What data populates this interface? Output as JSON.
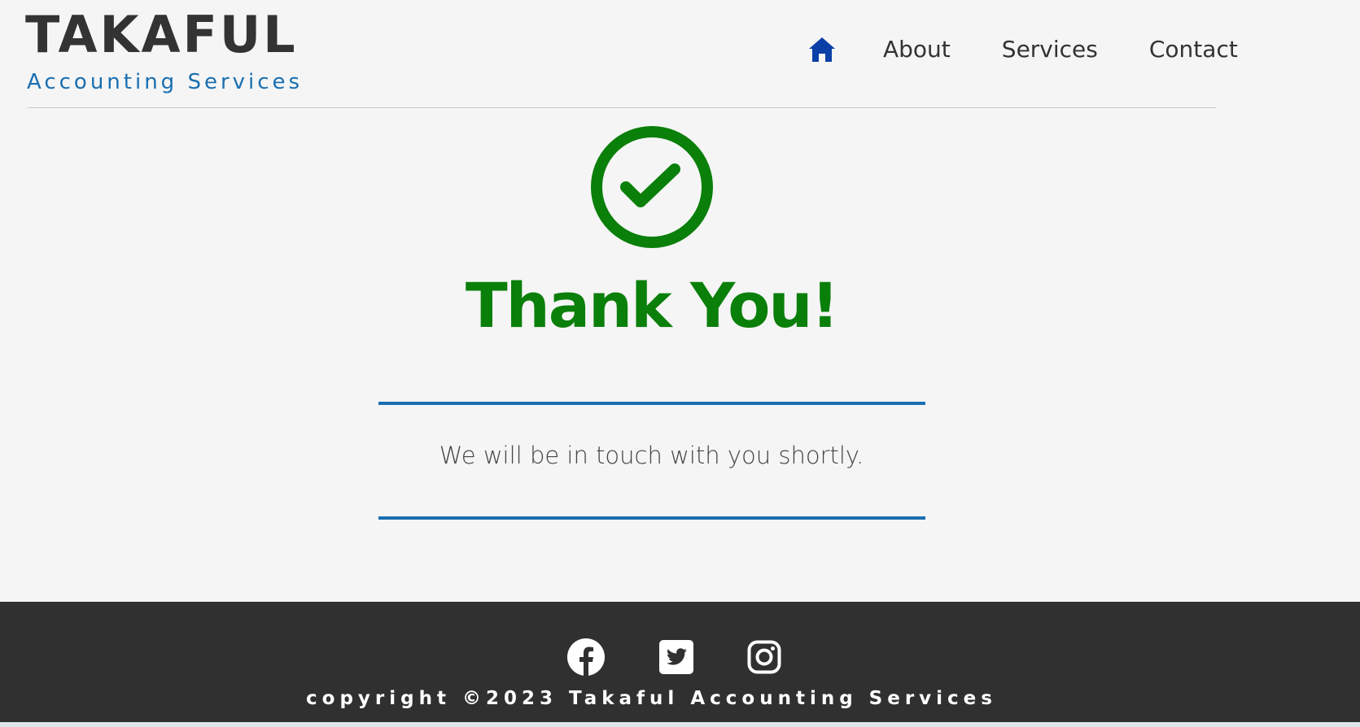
{
  "header": {
    "brand_title": "TAKAFUL",
    "brand_subtitle": "Accounting Services",
    "nav": {
      "home_icon": "home-icon",
      "about": "About",
      "services": "Services",
      "contact": "Contact"
    }
  },
  "main": {
    "status_icon": "check-circle-icon",
    "title": "Thank You!",
    "message": "We will be in touch with you shortly."
  },
  "footer": {
    "social_icons": [
      "facebook-icon",
      "twitter-icon",
      "instagram-icon"
    ],
    "copyright": "copyright ©2023 Takaful Accounting Services"
  },
  "colors": {
    "background": "#f5f5f5",
    "brand_dark": "#333333",
    "brand_blue": "#1a6fb0",
    "home_icon_blue": "#0b3fa8",
    "success_green": "#0a7f0a",
    "footer_bg": "#303030"
  }
}
